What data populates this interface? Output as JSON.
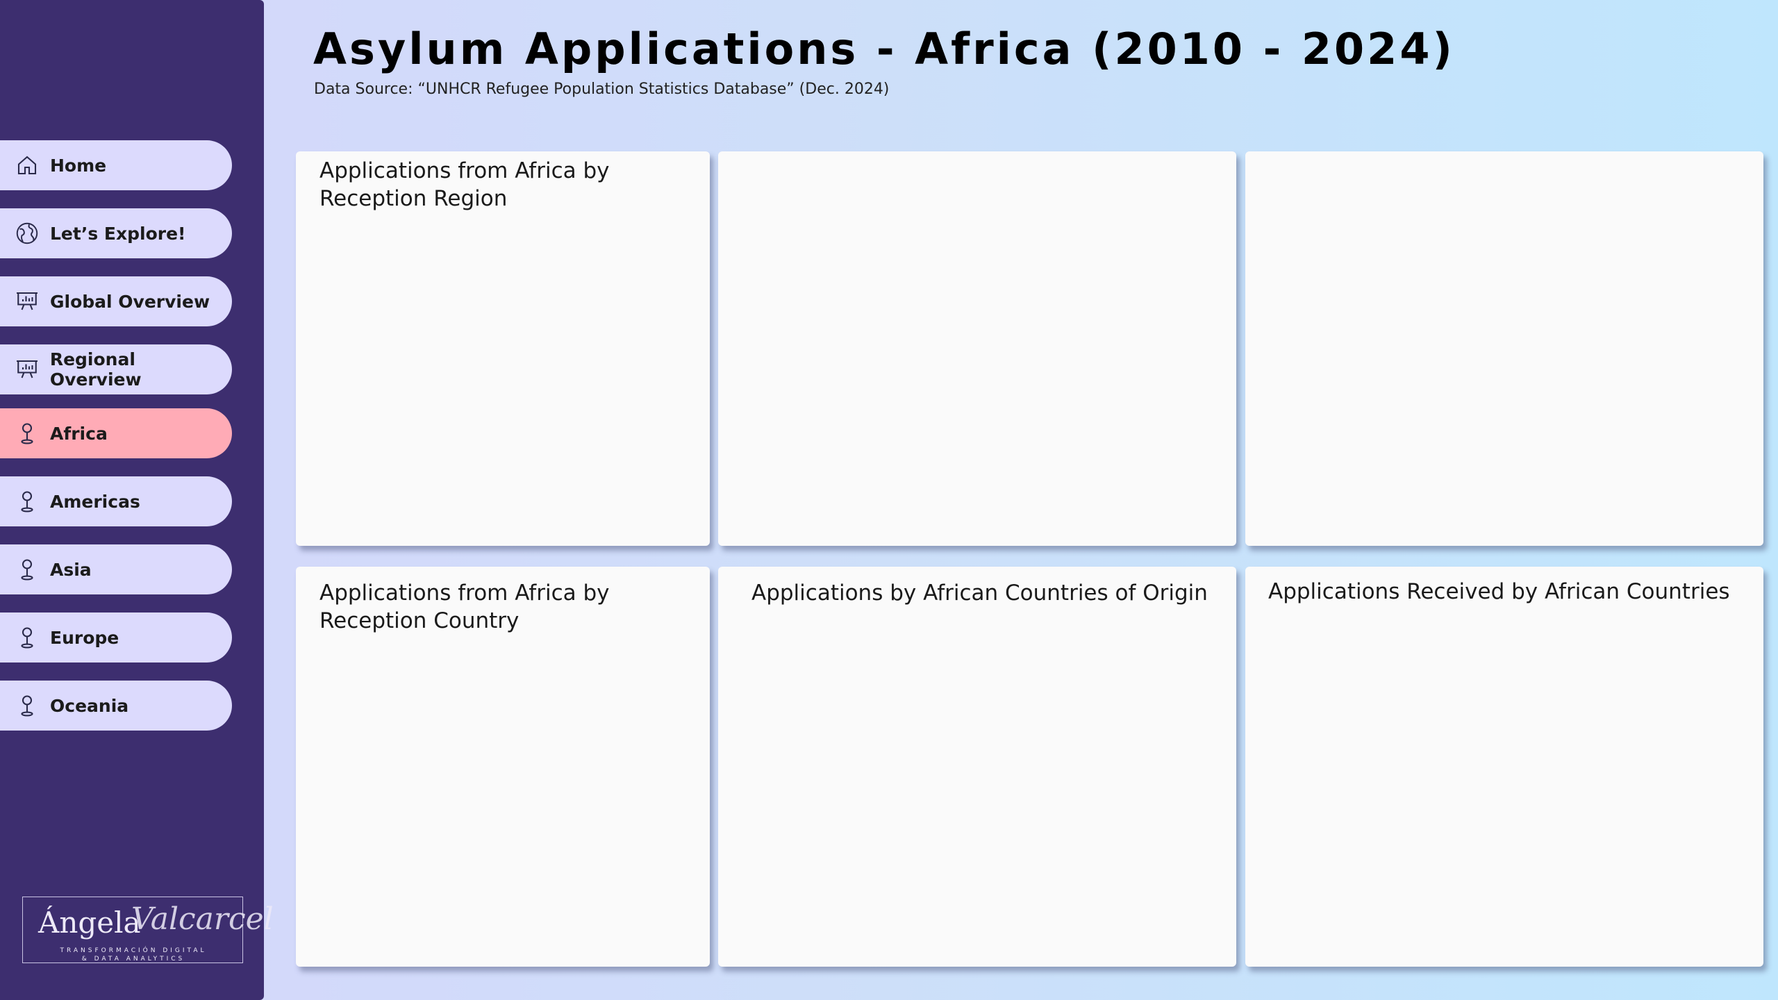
{
  "header": {
    "title": "Asylum Applications - Africa (2010 - 2024)",
    "subtitle": "Data Source:  “UNHCR Refugee Population Statistics Database” (Dec. 2024)"
  },
  "sidebar": {
    "active_item": "Africa",
    "active_color": "#ffabb6",
    "background_color": "#3d2e6f",
    "items": [
      {
        "label": "Home",
        "icon": "home-icon"
      },
      {
        "label": "Let’s Explore!",
        "icon": "globe-icon"
      },
      {
        "label": "Global Overview",
        "icon": "presentation-chart-icon"
      },
      {
        "label": "Regional Overview",
        "icon": "presentation-chart-icon"
      },
      {
        "label": "Africa",
        "icon": "map-pin-icon"
      },
      {
        "label": "Americas",
        "icon": "map-pin-icon"
      },
      {
        "label": "Asia",
        "icon": "map-pin-icon"
      },
      {
        "label": "Europe",
        "icon": "map-pin-icon"
      },
      {
        "label": "Oceania",
        "icon": "map-pin-icon"
      }
    ]
  },
  "logo": {
    "name": "Ángela",
    "signature": "Valcarcel",
    "tagline_line1": "TRANSFORMACIÓN DIGITAL",
    "tagline_line2": "& DATA ANALYTICS"
  },
  "cards": [
    {
      "title": "Applications from Africa by Reception Region"
    },
    {
      "title": ""
    },
    {
      "title": ""
    },
    {
      "title": "Applications from Africa by Reception Country"
    },
    {
      "title": "Applications by African Countries of Origin"
    },
    {
      "title": "Applications Received by African Countries"
    }
  ]
}
